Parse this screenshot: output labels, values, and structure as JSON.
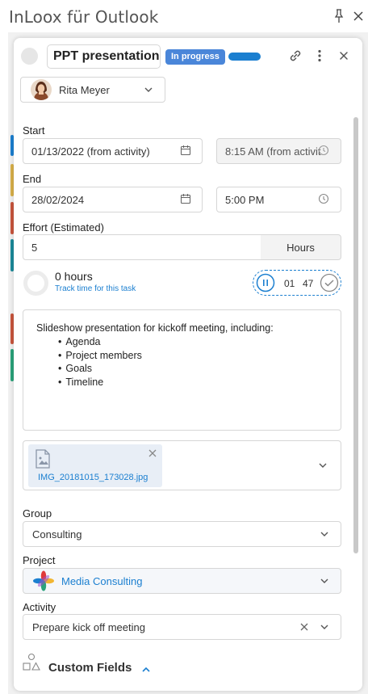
{
  "pane": {
    "title": "InLoox für Outlook"
  },
  "task": {
    "title": "PPT presentation",
    "status": "In progress",
    "owner": "Rita Meyer"
  },
  "schedule": {
    "start_label": "Start",
    "start_date": "01/13/2022 (from activity)",
    "start_time": "8:15 AM (from activit",
    "end_label": "End",
    "end_date": "28/02/2024",
    "end_time": "5:00 PM"
  },
  "effort": {
    "label": "Effort (Estimated)",
    "value": "5",
    "unit": "Hours"
  },
  "tracking": {
    "hours": "0 hours",
    "link": "Track time for this task",
    "minutes": "01",
    "seconds": "47"
  },
  "description": {
    "intro": "Slideshow presentation for kickoff meeting, including:",
    "items": [
      "Agenda",
      "Project members",
      "Goals",
      "Timeline"
    ]
  },
  "attachment": {
    "filename": "IMG_20181015_173028.jpg"
  },
  "group": {
    "label": "Group",
    "value": "Consulting"
  },
  "project": {
    "label": "Project",
    "value": "Media Consulting"
  },
  "activity": {
    "label": "Activity",
    "value": "Prepare kick off meeting"
  },
  "custom_fields": {
    "label": "Custom Fields"
  },
  "colors": {
    "accent": "#1b7fd0",
    "status_badge": "#4a86d9",
    "stripes": [
      "#1b7fd0",
      "#d8b04a",
      "#c8553d",
      "#1b8a9a",
      "#c8553d",
      "#2aa37a"
    ]
  }
}
